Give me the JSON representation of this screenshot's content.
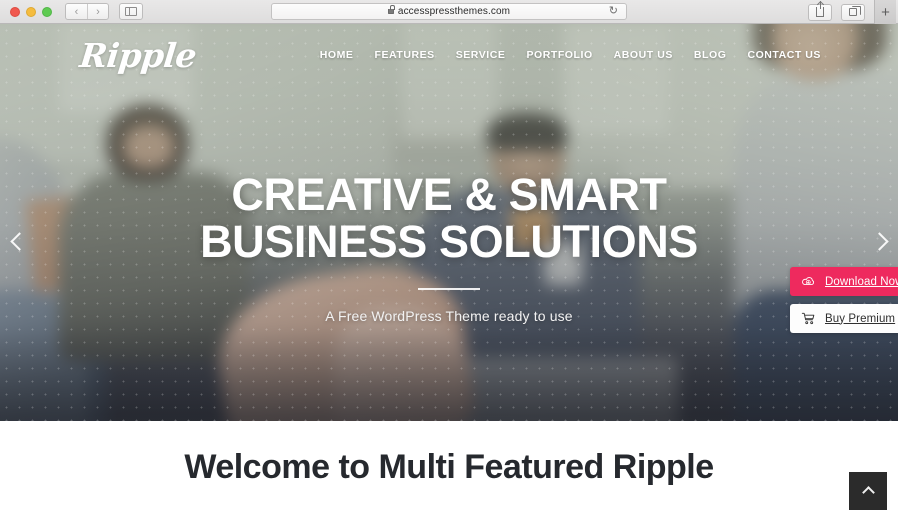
{
  "browser": {
    "traffic_lights": [
      "close",
      "minimize",
      "maximize"
    ],
    "back_label": "‹",
    "forward_label": "›",
    "sidebar_icon": "sidebar-icon",
    "url": "accesspressthemes.com",
    "lock_icon": "lock-icon",
    "reload_icon": "↻",
    "share_icon": "share-icon",
    "tabs_icon": "tabs-overview-icon",
    "new_tab_label": "+"
  },
  "site": {
    "logo": "Ripple",
    "nav": [
      {
        "label": "HOME"
      },
      {
        "label": "FEATURES"
      },
      {
        "label": "SERVICE"
      },
      {
        "label": "PORTFOLIO"
      },
      {
        "label": "ABOUT US"
      },
      {
        "label": "BLOG"
      },
      {
        "label": "CONTACT US"
      }
    ]
  },
  "hero": {
    "title_line1": "CREATIVE & SMART",
    "title_line2": "BUSINESS SOLUTIONS",
    "subtitle": "A Free WordPress Theme ready to use",
    "prev_arrow": "‹",
    "next_arrow": "›",
    "overlay_tone": "#8c9687"
  },
  "cta": {
    "download": {
      "label": "Download Now",
      "icon": "cloud-download-icon",
      "color": "#ee2a5e"
    },
    "premium": {
      "label": "Buy Premium",
      "icon": "shopping-cart-icon",
      "color": "#fdfdfd"
    }
  },
  "welcome": {
    "title": "Welcome to Multi Featured Ripple"
  },
  "back_to_top": {
    "icon": "chevron-up-icon",
    "color": "#2b2b2b"
  }
}
